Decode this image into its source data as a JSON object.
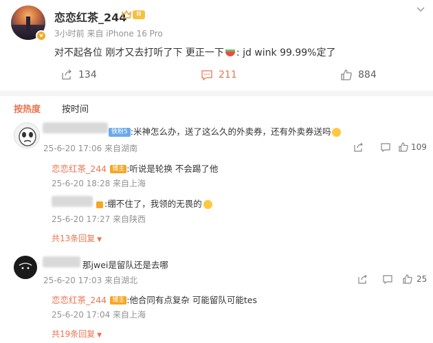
{
  "post": {
    "author": "恋恋红茶_244",
    "level_badge": "II",
    "meta": "3小时前  来自 iPhone 16 Pro",
    "text_before": "对不起各位 刚才又去打听了下 更正一下",
    "text_after": ":  jd wink 99.99%定了",
    "repost_count": "134",
    "comment_count": "211",
    "like_count": "884"
  },
  "sort": {
    "hot": "按热度",
    "time": "按时间"
  },
  "comments": [
    {
      "fan_tag": "铁粉5",
      "text": ":米神怎么办，送了这么久的外卖券，还有外卖券送吗",
      "meta": "25-6-20 17:06 来自湖南",
      "like_count": "109",
      "replies": [
        {
          "name": "恋恋红茶_244",
          "tag": "博主",
          "text": ":听说是轮换 不会踢了他",
          "meta": "25-6-20 18:28 来自上海"
        },
        {
          "text": ":绷不住了，我领的无畏的",
          "meta": "25-6-20 17:27 来自陕西"
        }
      ],
      "more": "共13条回复"
    },
    {
      "text": "那jwei是留队还是去哪",
      "meta": "25-6-20 17:03 来自湖北",
      "like_count": "25",
      "replies": [
        {
          "name": "恋恋红茶_244",
          "tag": "博主",
          "text": ":他合同有点复杂 可能留队可能tes",
          "meta": "25-6-20 17:04 来自上海"
        }
      ],
      "more": "共19条回复"
    }
  ],
  "colors": {
    "accent": "#eb7350",
    "meta": "#939393",
    "divider": "#f5f5f5"
  }
}
